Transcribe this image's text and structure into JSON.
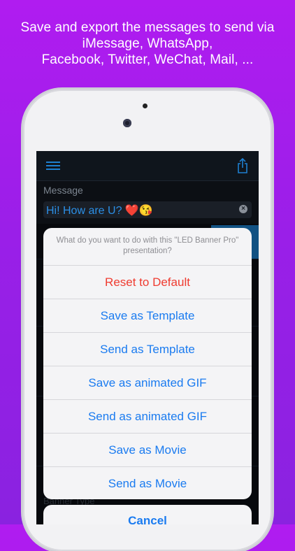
{
  "caption": {
    "line1": "Save and export the messages to send via",
    "line2": "iMessage, WhatsApp,",
    "line3": "Facebook, Twitter, WeChat, Mail, ..."
  },
  "app": {
    "message_label": "Message",
    "message_value": "Hi! How are U? ❤️😘",
    "banner_type_label": "Banner Type"
  },
  "action_sheet": {
    "message_line1": "What do you want to do with this \"LED Banner Pro\"",
    "message_line2": "presentation?",
    "items": [
      {
        "label": "Reset to Default",
        "style": "destructive"
      },
      {
        "label": "Save as Template",
        "style": "default"
      },
      {
        "label": "Send as Template",
        "style": "default"
      },
      {
        "label": "Save as animated GIF",
        "style": "default"
      },
      {
        "label": "Send as animated GIF",
        "style": "default"
      },
      {
        "label": "Save as Movie",
        "style": "default"
      },
      {
        "label": "Send as Movie",
        "style": "default"
      }
    ],
    "cancel_label": "Cancel"
  },
  "icons": {
    "menu": "hamburger-menu-icon",
    "share": "share-icon",
    "clear": "clear-text-icon"
  },
  "colors": {
    "accent": "#1a7bf0",
    "destructive": "#ef3b30",
    "background": "#9a1fe8"
  }
}
